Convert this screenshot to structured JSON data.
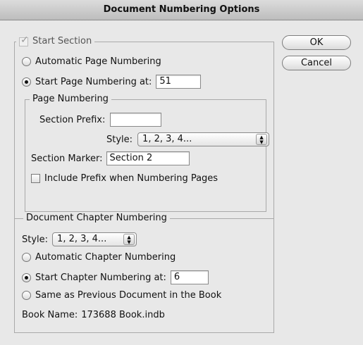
{
  "window": {
    "title": "Document Numbering Options"
  },
  "buttons": {
    "ok": "OK",
    "cancel": "Cancel"
  },
  "start_section": {
    "label": "Start Section",
    "checked": true,
    "automatic_label": "Automatic Page Numbering",
    "start_label": "Start Page Numbering at:",
    "start_value": "51",
    "selected": "start"
  },
  "page_numbering": {
    "legend": "Page Numbering",
    "prefix_label": "Section Prefix:",
    "prefix_value": "",
    "style_label": "Style:",
    "style_value": "1, 2, 3, 4...",
    "marker_label": "Section Marker:",
    "marker_value": "Section 2",
    "include_prefix_label": "Include Prefix when Numbering Pages",
    "include_prefix_checked": false
  },
  "chapter_numbering": {
    "legend": "Document Chapter Numbering",
    "style_label": "Style:",
    "style_value": "1, 2, 3, 4...",
    "automatic_label": "Automatic Chapter Numbering",
    "start_label": "Start Chapter Numbering at:",
    "start_value": "6",
    "same_label": "Same as Previous Document in the Book",
    "selected": "start",
    "book_name_label": "Book Name:",
    "book_name_value": "173688 Book.indb"
  },
  "icons": {
    "checkmark": "checkmark-icon",
    "popup_arrows": "updown-arrows-icon"
  }
}
